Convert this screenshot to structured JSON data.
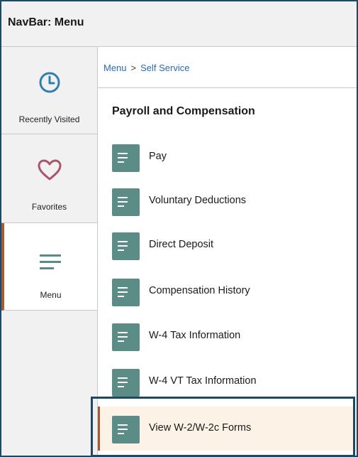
{
  "header": {
    "title": "NavBar: Menu"
  },
  "nav": {
    "items": [
      {
        "label": "Recently Visited",
        "icon": "clock-icon"
      },
      {
        "label": "Favorites",
        "icon": "heart-icon"
      },
      {
        "label": "Menu",
        "icon": "menu-lines-icon",
        "active": true
      }
    ]
  },
  "breadcrumb": {
    "root": "Menu",
    "separator": ">",
    "current": "Self Service"
  },
  "section": {
    "title": "Payroll and Compensation"
  },
  "menu": {
    "items": [
      {
        "label": "Pay"
      },
      {
        "label": "Voluntary Deductions"
      },
      {
        "label": "Direct Deposit"
      },
      {
        "label": "Compensation History"
      },
      {
        "label": "W-4 Tax Information"
      },
      {
        "label": "W-4 VT Tax Information"
      },
      {
        "label": "View W-2/W-2c Forms",
        "selected": true
      }
    ]
  },
  "colors": {
    "frame": "#1c4a66",
    "accent": "#a65a37",
    "icon_tile": "#5b8c85",
    "clock": "#2f7fb0",
    "heart": "#a9566a",
    "selected_bg": "#fdf2e6",
    "link": "#2a6ab0"
  }
}
